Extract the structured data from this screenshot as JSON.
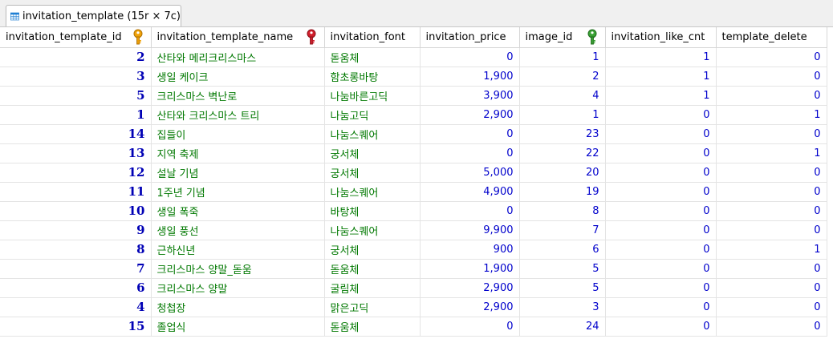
{
  "tab": {
    "label": "invitation_template (15r × 7c)",
    "icon": "table-grid-icon"
  },
  "columns": [
    {
      "label": "invitation_template_id",
      "key": "primary-key-icon",
      "key_color": "#f0a30a"
    },
    {
      "label": "invitation_template_name",
      "key": "unique-key-icon",
      "key_color": "#d21f2c"
    },
    {
      "label": "invitation_font"
    },
    {
      "label": "invitation_price"
    },
    {
      "label": "image_id",
      "key": "foreign-key-icon",
      "key_color": "#3aa335"
    },
    {
      "label": "invitation_like_cnt"
    },
    {
      "label": "template_delete"
    }
  ],
  "rows": [
    [
      "2",
      "산타와 메리크리스마스",
      "돋움체",
      "0",
      "1",
      "1",
      "0"
    ],
    [
      "3",
      "생일 케이크",
      "함초롱바탕",
      "1,900",
      "2",
      "1",
      "0"
    ],
    [
      "5",
      "크리스마스 벽난로",
      "나눔바른고딕",
      "3,900",
      "4",
      "1",
      "0"
    ],
    [
      "1",
      "산타와 크리스마스 트리",
      "나눔고딕",
      "2,900",
      "1",
      "0",
      "1"
    ],
    [
      "14",
      "집들이",
      "나눔스퀘어",
      "0",
      "23",
      "0",
      "0"
    ],
    [
      "13",
      "지역 축제",
      "궁서체",
      "0",
      "22",
      "0",
      "1"
    ],
    [
      "12",
      "설날 기념",
      "궁서체",
      "5,000",
      "20",
      "0",
      "0"
    ],
    [
      "11",
      "1주년 기념",
      "나눔스퀘어",
      "4,900",
      "19",
      "0",
      "0"
    ],
    [
      "10",
      "생일 폭죽",
      "바탕체",
      "0",
      "8",
      "0",
      "0"
    ],
    [
      "9",
      "생일 풍선",
      "나눔스퀘어",
      "9,900",
      "7",
      "0",
      "0"
    ],
    [
      "8",
      "근하신년",
      "궁서체",
      "900",
      "6",
      "0",
      "1"
    ],
    [
      "7",
      "크리스마스 양말_돋움",
      "돋움체",
      "1,900",
      "5",
      "0",
      "0"
    ],
    [
      "6",
      "크리스마스 양말",
      "굴림체",
      "2,900",
      "5",
      "0",
      "0"
    ],
    [
      "4",
      "청첩장",
      "맑은고딕",
      "2,900",
      "3",
      "0",
      "0"
    ],
    [
      "15",
      "졸업식",
      "돋움체",
      "0",
      "24",
      "0",
      "0"
    ]
  ]
}
